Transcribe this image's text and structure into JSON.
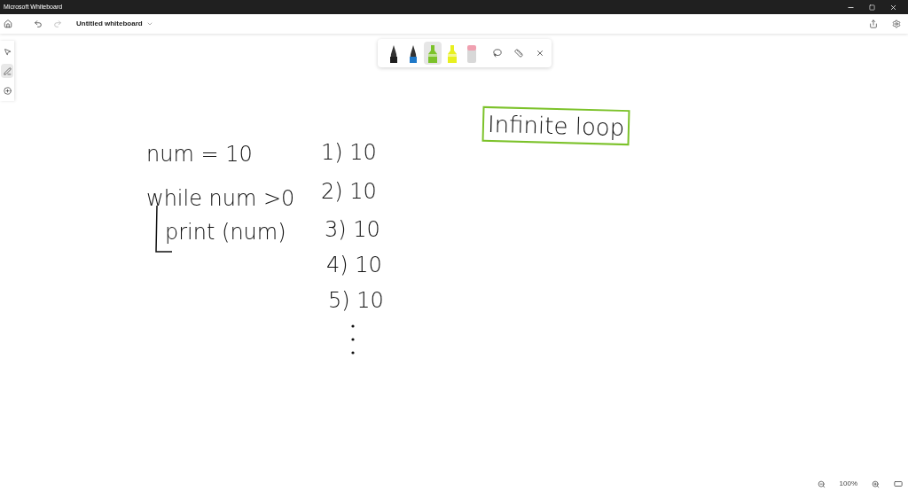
{
  "window": {
    "title": "Microsoft Whiteboard"
  },
  "board": {
    "title": "Untitled whiteboard"
  },
  "rail": [
    {
      "kind": "select",
      "selected": false
    },
    {
      "kind": "ink",
      "selected": true
    },
    {
      "kind": "add",
      "selected": false
    }
  ],
  "pen_tray": [
    {
      "kind": "pen",
      "color": "#1f1f1f",
      "selected": false
    },
    {
      "kind": "pen",
      "color": "#1f78c8",
      "selected": false
    },
    {
      "kind": "highlighter",
      "color": "#7cc22a",
      "selected": true
    },
    {
      "kind": "highlighter",
      "color": "#e8f020",
      "selected": false
    },
    {
      "kind": "eraser",
      "color": "#f0a0b0",
      "selected": false
    }
  ],
  "canvas": {
    "ink": [
      {
        "text": "num = 10"
      },
      {
        "text": "while num >0"
      },
      {
        "text": "print (num)"
      },
      {
        "text": "1)  10"
      },
      {
        "text": "2) 10"
      },
      {
        "text": "3) 10"
      },
      {
        "text": "4) 10"
      },
      {
        "text": "5) 10"
      }
    ],
    "boxed": {
      "text": "Infinite loop",
      "color": "#7cc22a"
    }
  },
  "zoom": {
    "value": "100%"
  }
}
